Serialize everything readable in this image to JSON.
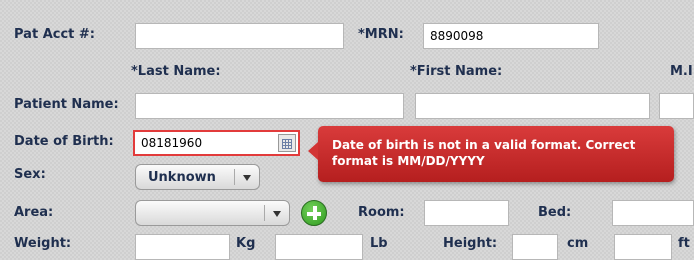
{
  "labels": {
    "pat_acct": "Pat Acct #:",
    "mrn": "*MRN:",
    "last_name": "*Last Name:",
    "first_name": "*First Name:",
    "mi": "M.I",
    "patient_name": "Patient Name:",
    "dob": "Date of Birth:",
    "sex": "Sex:",
    "area": "Area:",
    "room": "Room:",
    "bed": "Bed:",
    "weight": "Weight:",
    "kg": "Kg",
    "lb": "Lb",
    "height": "Height:",
    "cm": "cm",
    "ft": "ft"
  },
  "fields": {
    "pat_acct": "",
    "mrn": "8890098",
    "last_name": "",
    "first_name": "",
    "middle_initial": "",
    "dob": "08181960",
    "room": "",
    "bed": "",
    "weight_kg": "",
    "weight_lb": "",
    "height_cm": "",
    "height_ft": ""
  },
  "selects": {
    "sex": "Unknown",
    "area": ""
  },
  "error_tooltip": "Date of birth is not in a valid format. Correct format is MM/DD/YYYY",
  "icons": {
    "calendar": "calendar-icon",
    "add": "plus-circle-icon"
  },
  "colors": {
    "error": "#e23b3b",
    "tooltip": "#c62828",
    "label": "#1f2f4f",
    "add_button": "#3aa62a"
  }
}
